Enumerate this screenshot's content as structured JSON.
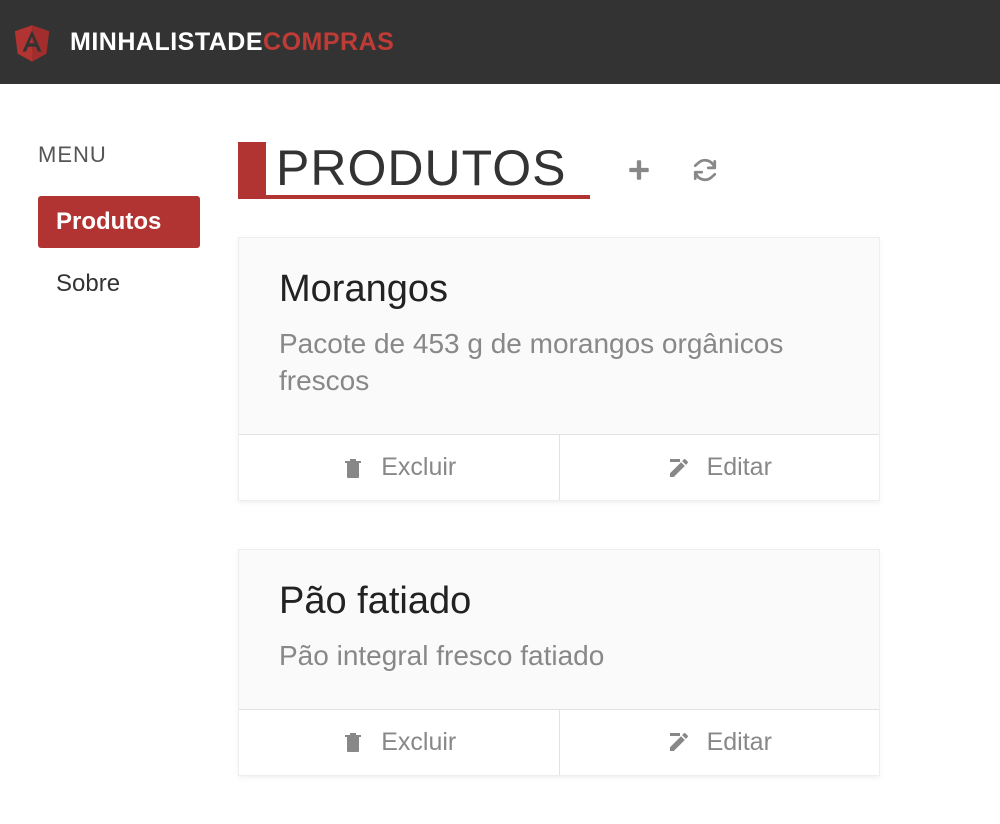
{
  "brand": {
    "part1": "MINHA",
    "part2": "LISTADE",
    "part3": "COMPRAS"
  },
  "sidebar": {
    "header": "MENU",
    "items": [
      {
        "label": "Produtos",
        "active": true
      },
      {
        "label": "Sobre",
        "active": false
      }
    ]
  },
  "page": {
    "title": "PRODUTOS"
  },
  "actions": {
    "delete": "Excluir",
    "edit": "Editar"
  },
  "products": [
    {
      "name": "Morangos",
      "description": "Pacote de 453 g de morangos orgânicos frescos"
    },
    {
      "name": "Pão fatiado",
      "description": "Pão integral fresco fatiado"
    }
  ],
  "colors": {
    "accent": "#b13432",
    "headerBg": "#333333"
  }
}
